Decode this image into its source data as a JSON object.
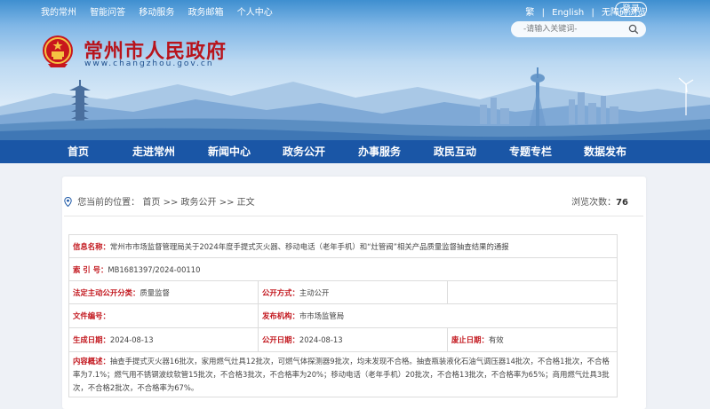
{
  "top_links": [
    "我的常州",
    "智能问答",
    "移动服务",
    "政务邮箱",
    "个人中心"
  ],
  "top_right": {
    "lang_trad": "繁",
    "sep1": "|",
    "lang_en": "English",
    "sep2": "|",
    "accessibility": "无障碍浏览",
    "login": "登录"
  },
  "search": {
    "placeholder": "-请输入关键词-"
  },
  "site": {
    "title": "常州市人民政府",
    "url": "www.changzhou.gov.cn"
  },
  "nav": [
    "首页",
    "走进常州",
    "新闻中心",
    "政务公开",
    "办事服务",
    "政民互动",
    "专题专栏",
    "数据发布"
  ],
  "breadcrumb": {
    "prefix": "您当前的位置：",
    "items": [
      "首页",
      ">>",
      "政务公开",
      ">>",
      "正文"
    ]
  },
  "views": {
    "label": "浏览次数：",
    "count": "76"
  },
  "meta": {
    "info_summary_label": "信息名称：",
    "info_summary": "常州市市场监督管理局关于2024年度手提式灭火器、移动电话（老年手机）和“灶管阀”相关产品质量监督抽查结果的通报",
    "index_label": "索 引 号：",
    "index": "MB1681397/2024-00110",
    "category_label": "法定主动公开分类：",
    "category": "质量监督",
    "open_mode_label": "公开方式：",
    "open_mode": "主动公开",
    "doc_no_label": "文件编号：",
    "doc_no": "",
    "publisher_label": "发布机构：",
    "publisher": "市市场监管局",
    "created_label": "生成日期：",
    "created": "2024-08-13",
    "open_date_label": "公开日期：",
    "open_date": "2024-08-13",
    "validity_label": "废止日期：",
    "validity": "有效",
    "content_label": "内容概述：",
    "content": "抽查手提式灭火器16批次，家用燃气灶具12批次，可燃气体探测器9批次，均未发现不合格。抽查瓶装液化石油气调压器14批次，不合格1批次，不合格率为7.1%；燃气用不锈钢波纹软管15批次，不合格3批次，不合格率为20%；移动电话（老年手机）20批次，不合格13批次，不合格率为65%；商用燃气灶具3批次，不合格2批次，不合格率为67%。"
  },
  "colors": {
    "nav": "#1a56a6",
    "title": "#b8141c",
    "label": "#c2161d"
  }
}
